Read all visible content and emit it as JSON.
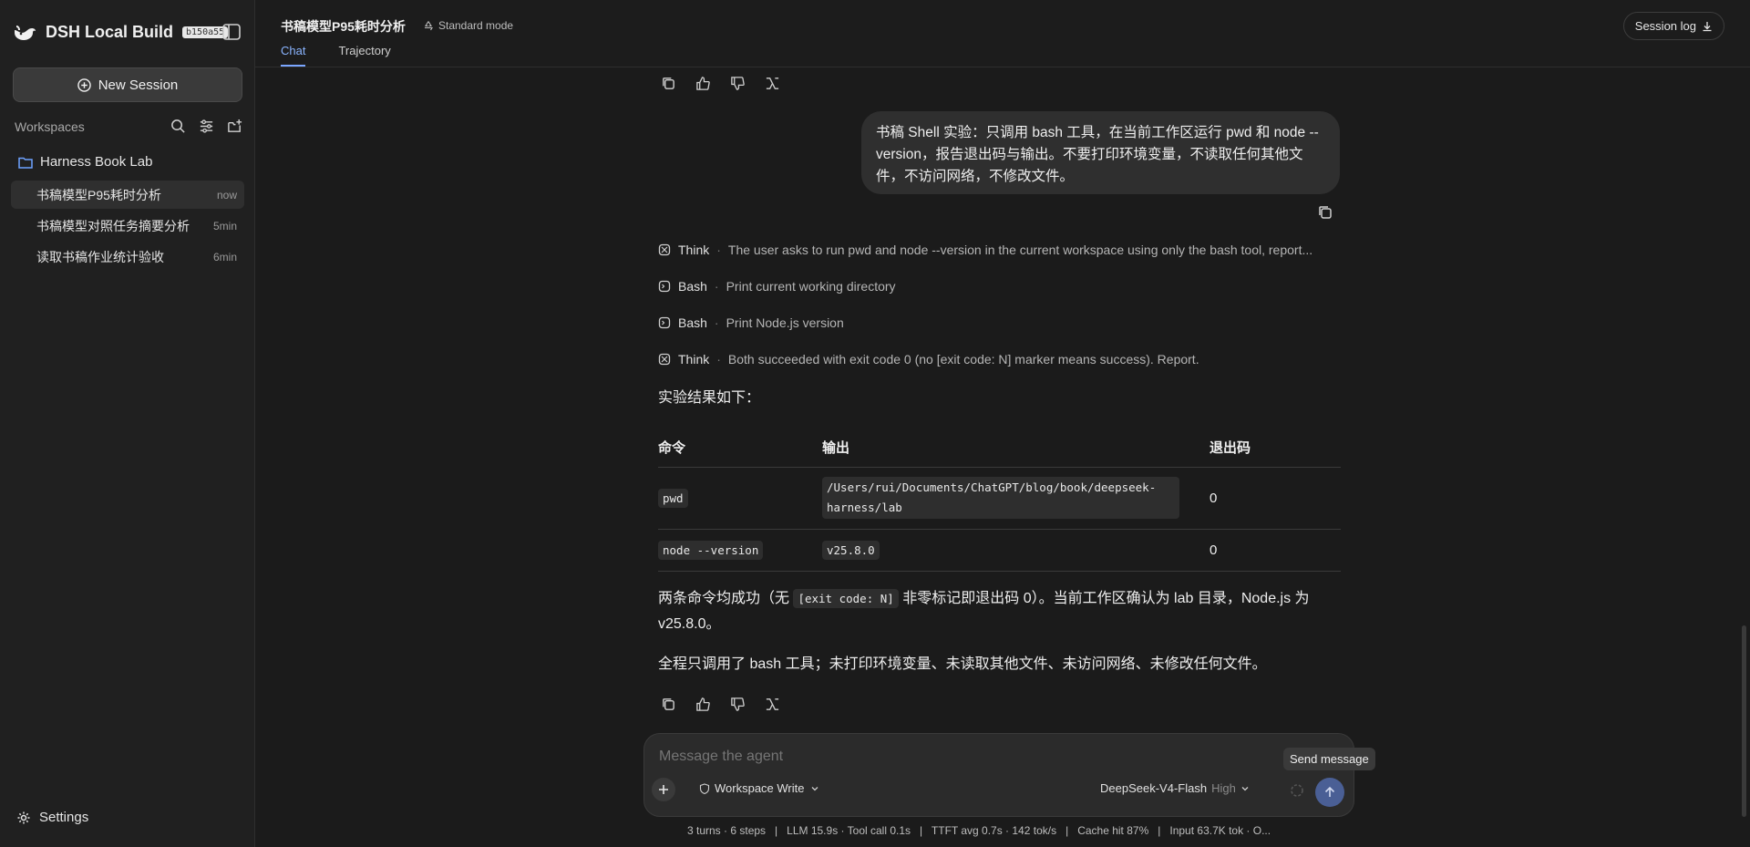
{
  "app": {
    "title": "DSH Local Build",
    "build": "b150a55"
  },
  "sidebar": {
    "new_session": "New Session",
    "workspaces_label": "Workspaces",
    "workspace_name": "Harness Book Lab",
    "sessions": [
      {
        "title": "书稿模型P95耗时分析",
        "time": "now",
        "active": true
      },
      {
        "title": "书稿模型对照任务摘要分析",
        "time": "5min",
        "active": false
      },
      {
        "title": "读取书稿作业统计验收",
        "time": "6min",
        "active": false
      }
    ],
    "settings": "Settings"
  },
  "header": {
    "session_title": "书稿模型P95耗时分析",
    "mode": "Standard mode",
    "tabs": [
      "Chat",
      "Trajectory"
    ],
    "session_log": "Session log"
  },
  "conversation": {
    "user_message": "书稿 Shell 实验：只调用 bash 工具，在当前工作区运行 pwd 和 node --version，报告退出码与输出。不要打印环境变量，不读取任何其他文件，不访问网络，不修改文件。",
    "steps": [
      {
        "kind": "Think",
        "icon": "brain-icon",
        "desc": "The user asks to run pwd and node --version in the current workspace using only the bash tool, report..."
      },
      {
        "kind": "Bash",
        "icon": "terminal-icon",
        "desc": "Print current working directory"
      },
      {
        "kind": "Bash",
        "icon": "terminal-icon",
        "desc": "Print Node.js version"
      },
      {
        "kind": "Think",
        "icon": "brain-icon",
        "desc": "Both succeeded with exit code 0 (no [exit code: N] marker means success). Report."
      }
    ],
    "intro": "实验结果如下：",
    "table": {
      "headers": [
        "命令",
        "输出",
        "退出码"
      ],
      "rows": [
        {
          "cmd": "pwd",
          "output": "/Users/rui/Documents/ChatGPT/blog/book/deepseek-harness/lab",
          "code": "0"
        },
        {
          "cmd": "node --version",
          "output": "v25.8.0",
          "code": "0"
        }
      ]
    },
    "summary_pre": "两条命令均成功（无 ",
    "summary_code": "[exit code: N]",
    "summary_post": " 非零标记即退出码 0）。当前工作区确认为 lab 目录，Node.js 为 v25.8.0。",
    "closing": "全程只调用了 bash 工具；未打印环境变量、未读取其他文件、未访问网络、未修改任何文件。"
  },
  "composer": {
    "placeholder": "Message the agent",
    "permission": "Workspace Write",
    "model": "DeepSeek-V4-Flash",
    "effort": "High",
    "send_tooltip": "Send message"
  },
  "stats": "3 turns · 6 steps   |   LLM 15.9s · Tool call 0.1s   |   TTFT avg 0.7s · 142 tok/s   |   Cache hit 87%   |   Input 63.7K tok · O..."
}
